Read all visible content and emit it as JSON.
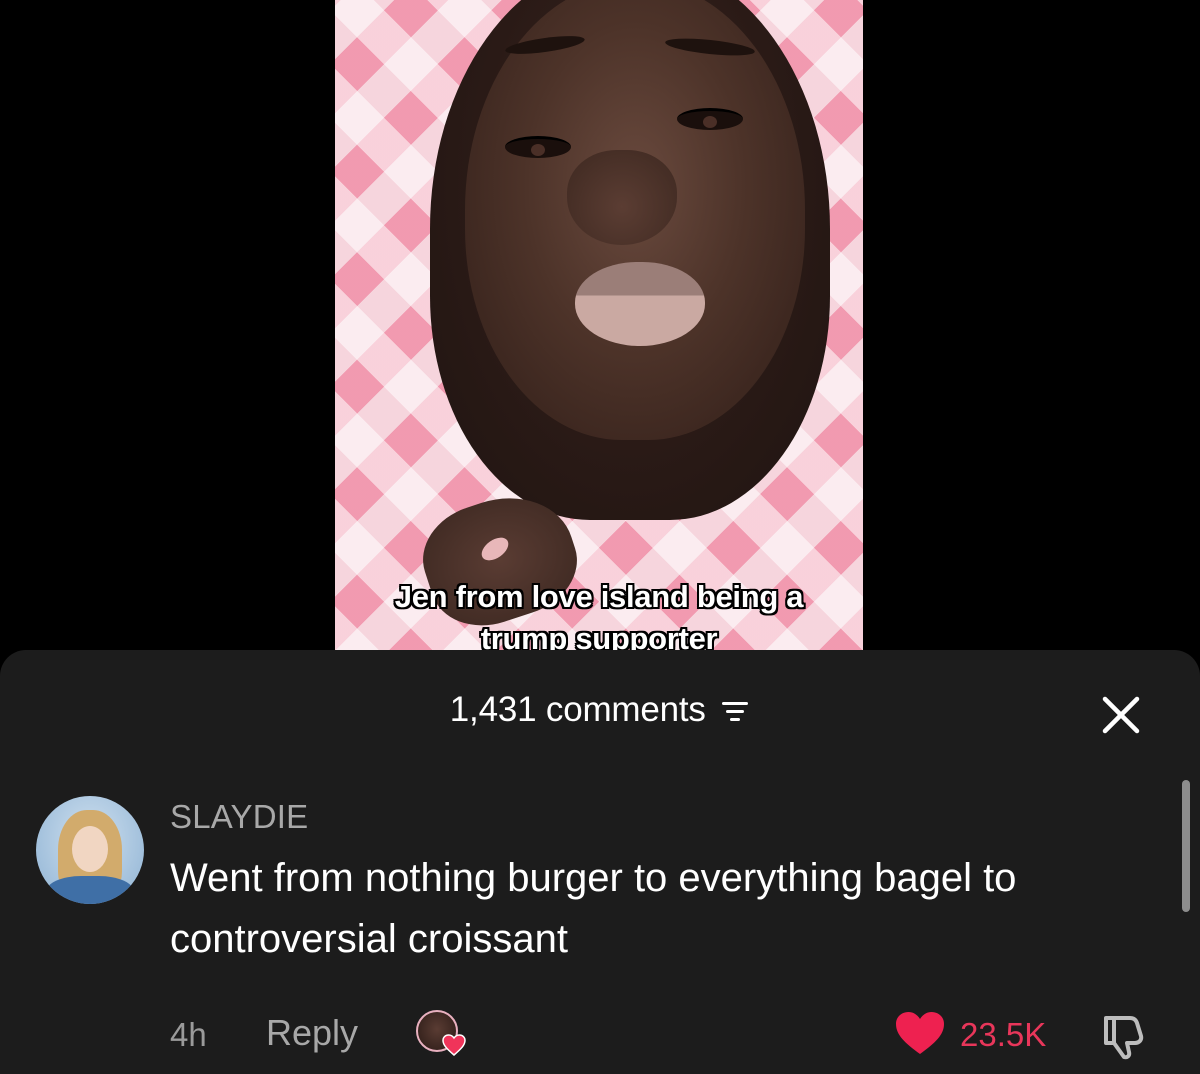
{
  "video": {
    "caption_line1": "Jen from love island being a",
    "caption_line2": "trump supporter"
  },
  "comments_panel": {
    "count_label": "1,431 comments",
    "sort_icon": "filter-lines-icon",
    "close_icon": "close-icon"
  },
  "comment": {
    "username": "SLAYDIE",
    "text": "Went from nothing burger to everything bagel to controversial croissant",
    "time": "4h",
    "reply_label": "Reply",
    "likes": "23.5K",
    "like_icon": "heart-icon",
    "dislike_icon": "thumbs-down-icon",
    "creator_liked": true
  },
  "colors": {
    "sheet_bg": "#1c1c1c",
    "like_red": "#e8365a",
    "muted_text": "#a8a8a8"
  }
}
